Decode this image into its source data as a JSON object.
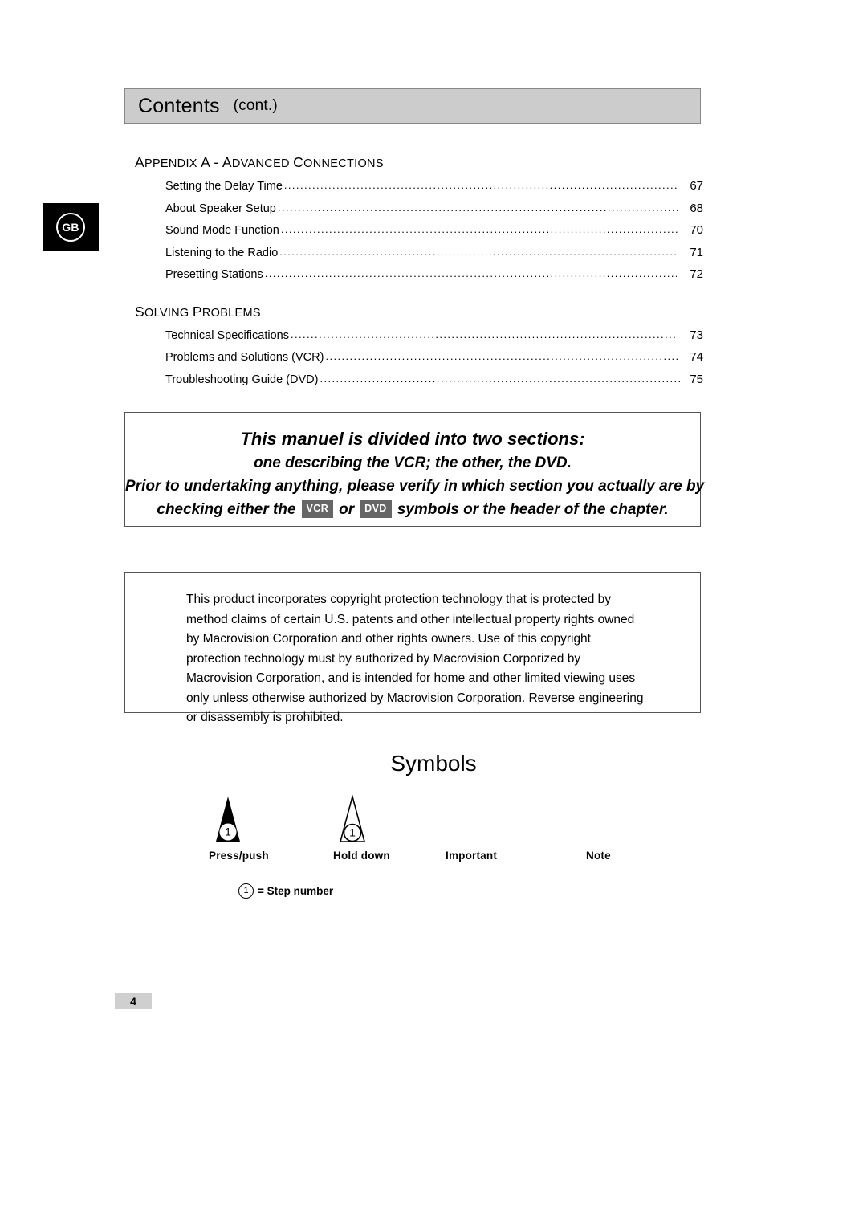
{
  "language_tab": {
    "code": "GB"
  },
  "header": {
    "title": "Contents",
    "subtitle": "(cont.)"
  },
  "toc": {
    "sections": [
      {
        "heading_parts": {
          "p1": "A",
          "p2": "PPENDIX",
          "p3": "A",
          "p4": "-",
          "p5": "A",
          "p6": "DVANCED",
          "p7": "C",
          "p8": "ONNECTIONS"
        },
        "heading_text": "APPENDIX A - ADVANCED CONNECTIONS",
        "entries": [
          {
            "label": "Setting the Delay Time",
            "page": "67"
          },
          {
            "label": "About Speaker Setup",
            "page": "68"
          },
          {
            "label": "Sound Mode Function",
            "page": "70"
          },
          {
            "label": "Listening to the Radio",
            "page": "71"
          },
          {
            "label": "Presetting Stations",
            "page": "72"
          }
        ]
      },
      {
        "heading_parts": {
          "p1": "S",
          "p2": "OLVING",
          "p3": "P",
          "p4": "ROBLEMS"
        },
        "heading_text": "SOLVING PROBLEMS",
        "entries": [
          {
            "label": "Technical Specifications",
            "page": "73"
          },
          {
            "label": "Problems and Solutions (VCR)",
            "page": "74"
          },
          {
            "label": "Troubleshooting Guide (DVD)",
            "page": "75"
          }
        ]
      }
    ],
    "leader": "...................................................................................................................................................."
  },
  "callout": {
    "line1": "This manuel is divided into two sections:",
    "line2": "one describing the VCR; the other, the DVD.",
    "line3": "Prior to undertaking anything, please verify in which section you actually are by",
    "line4_a": "checking either the",
    "tag_vcr": "VCR",
    "line4_b": "or",
    "tag_dvd": "DVD",
    "line4_c": "symbols or the header of the chapter."
  },
  "copyright": {
    "text": "This product incorporates copyright protection technology that is protected by method claims of certain U.S. patents and other intellectual property rights owned by Macrovision Corporation and other rights owners. Use of this copyright protection technology must by authorized by Macrovision Corporized by Macrovision Corporation, and is intended for home and other limited viewing uses only unless otherwise authorized by Macrovision Corporation. Reverse engineering or disassembly is prohibited."
  },
  "symbols": {
    "title": "Symbols",
    "items": [
      {
        "label": "Press/push",
        "glyph": "filled-triangle-step-icon",
        "step": "1"
      },
      {
        "label": "Hold down",
        "glyph": "outline-triangle-step-icon",
        "step": "1"
      },
      {
        "label": "Important",
        "glyph": "none"
      },
      {
        "label": "Note",
        "glyph": "none"
      }
    ],
    "legend": {
      "step": "1",
      "text": "= Step number"
    }
  },
  "footer": {
    "page_number": "4"
  },
  "colors": {
    "header_band": "#cccccc",
    "tag_badge": "#666666",
    "lang_tab": "#000000",
    "footer_box": "#cfcfcf"
  }
}
